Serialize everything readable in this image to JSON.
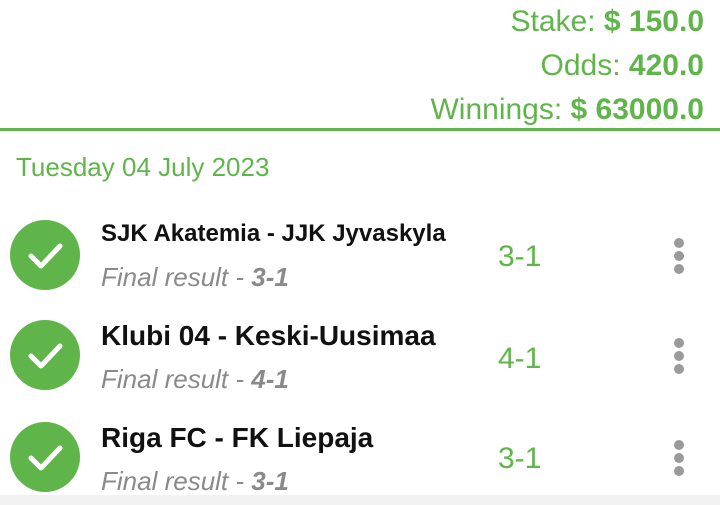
{
  "summary": {
    "stake_label": "Stake:",
    "stake_value": "$ 150.0",
    "odds_label": "Odds:",
    "odds_value": "420.0",
    "winnings_label": "Winnings:",
    "winnings_value": "$ 63000.0"
  },
  "date_heading": "Tuesday 04 July 2023",
  "matches": [
    {
      "teams": "SJK Akatemia - JJK Jyvaskyla",
      "result_label": "Final result - ",
      "result_value": "3-1",
      "pick": "3-1",
      "status_icon": "check-icon"
    },
    {
      "teams": "Klubi 04 - Keski-Uusimaa",
      "result_label": "Final result - ",
      "result_value": "4-1",
      "pick": "4-1",
      "status_icon": "check-icon"
    },
    {
      "teams": "Riga FC - FK Liepaja",
      "result_label": "Final result - ",
      "result_value": "3-1",
      "pick": "3-1",
      "status_icon": "check-icon"
    }
  ],
  "colors": {
    "accent": "#5fb54a",
    "text": "#111111",
    "muted": "#8a8a8a",
    "menu_dots": "#9a9a9a"
  },
  "icons": {
    "more": "more-vertical-icon"
  }
}
